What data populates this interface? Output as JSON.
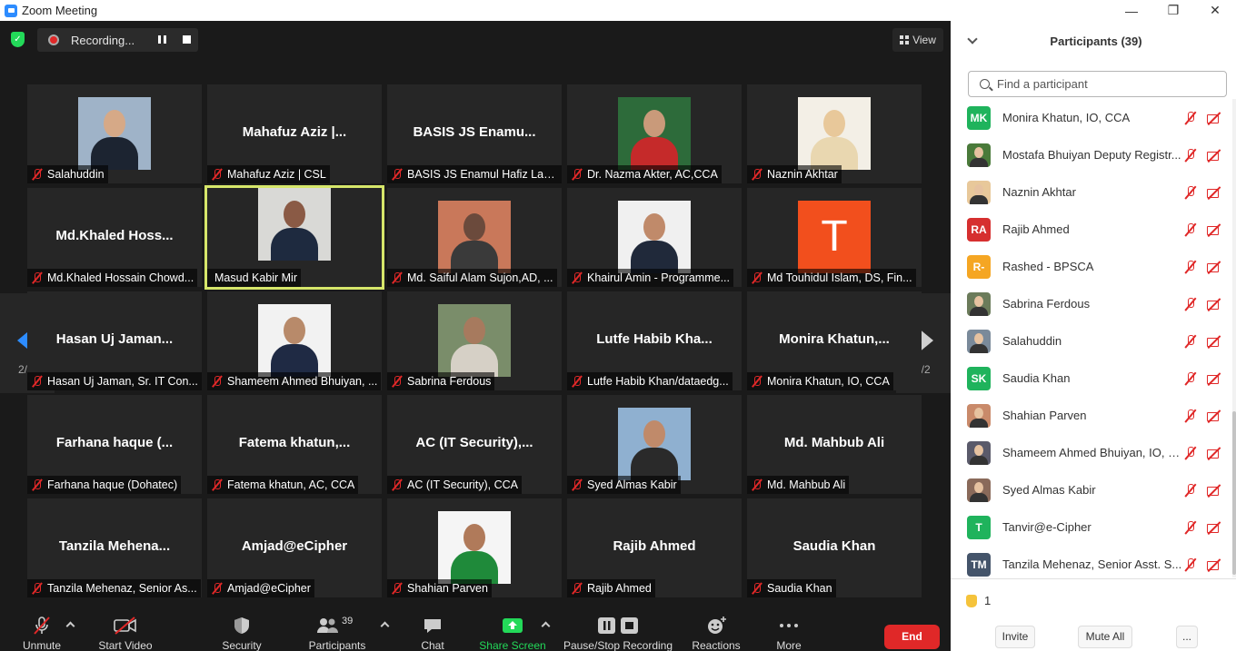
{
  "window": {
    "title": "Zoom Meeting",
    "controls": [
      "—",
      "❐",
      "✕"
    ]
  },
  "topbar": {
    "recording_label": "Recording...",
    "view_label": "View"
  },
  "grid": {
    "page_indicator": "2/2",
    "tiles": [
      {
        "big": "",
        "name": "Salahuddin",
        "photo": "man-suit"
      },
      {
        "big": "Mahafuz Aziz |...",
        "name": "Mahafuz Aziz | CSL"
      },
      {
        "big": "BASIS JS Enamu...",
        "name": "BASIS JS Enamul Hafiz Latif..."
      },
      {
        "big": "",
        "name": "Dr. Nazma Akter, AC,CCA",
        "photo": "woman-red"
      },
      {
        "big": "",
        "name": "Naznin Akhtar",
        "photo": "woman-hijab"
      },
      {
        "big": "Md.Khaled  Hoss...",
        "name": "Md.Khaled Hossain Chowd..."
      },
      {
        "big": "",
        "name": "Masud Kabir Mir",
        "photo": "man-office",
        "active": true
      },
      {
        "big": "",
        "name": "Md. Saiful Alam Sujon,AD, ...",
        "photo": "man-casual"
      },
      {
        "big": "",
        "name": "Khairul Amin - Programme...",
        "photo": "man-beard"
      },
      {
        "big": "",
        "name": "Md Touhidul Islam, DS, Fin...",
        "avatar_letter": "T"
      },
      {
        "big": "Hasan Uj Jaman...",
        "name": "Hasan Uj Jaman, Sr. IT Con..."
      },
      {
        "big": "",
        "name": "Shameem Ahmed Bhuiyan, ...",
        "photo": "man-suit2"
      },
      {
        "big": "",
        "name": "Sabrina Ferdous",
        "photo": "woman-outdoor"
      },
      {
        "big": "Lutfe  Habib  Kha...",
        "name": "Lutfe Habib Khan/dataedg..."
      },
      {
        "big": "Monira  Khatun,...",
        "name": "Monira Khatun, IO, CCA"
      },
      {
        "big": "Farhana haque (...",
        "name": "Farhana haque (Dohatec)"
      },
      {
        "big": "Fatema  khatun,...",
        "name": "Fatema khatun, AC, CCA"
      },
      {
        "big": "AC (IT Security),...",
        "name": "AC (IT Security), CCA"
      },
      {
        "big": "",
        "name": "Syed Almas Kabir",
        "photo": "man-smile"
      },
      {
        "big": "Md. Mahbub Ali",
        "name": "Md. Mahbub Ali"
      },
      {
        "big": "Tanzila  Mehena...",
        "name": "Tanzila Mehenaz, Senior As..."
      },
      {
        "big": "Amjad@eCipher",
        "name": "Amjad@eCipher"
      },
      {
        "big": "",
        "name": "Shahian Parven",
        "photo": "woman-green"
      },
      {
        "big": "Rajib Ahmed",
        "name": "Rajib Ahmed"
      },
      {
        "big": "Saudia Khan",
        "name": "Saudia Khan"
      }
    ]
  },
  "toolbar": {
    "unmute": "Unmute",
    "start_video": "Start Video",
    "security": "Security",
    "participants": "Participants",
    "participants_count": "39",
    "chat": "Chat",
    "share_screen": "Share Screen",
    "pause_stop": "Pause/Stop Recording",
    "reactions": "Reactions",
    "more": "More",
    "end": "End"
  },
  "panel": {
    "title": "Participants (39)",
    "search_placeholder": "Find a participant",
    "raised_hands": "1",
    "invite": "Invite",
    "mute_all": "Mute All",
    "more": "...",
    "participants": [
      {
        "name": "Monira Khatun, IO, CCA",
        "initials": "MK",
        "color": "#1fb35c"
      },
      {
        "name": "Mostafa Bhuiyan Deputy Registr...",
        "initials": "",
        "color": "#4a7a3a",
        "pic": true
      },
      {
        "name": "Naznin Akhtar",
        "initials": "",
        "color": "#e8c89a",
        "pic": true
      },
      {
        "name": "Rajib Ahmed",
        "initials": "RA",
        "color": "#d62f2f"
      },
      {
        "name": "Rashed - BPSCA",
        "initials": "R-",
        "color": "#f5a623"
      },
      {
        "name": "Sabrina Ferdous",
        "initials": "",
        "color": "#6b7b5a",
        "pic": true
      },
      {
        "name": "Salahuddin",
        "initials": "",
        "color": "#7a8a9a",
        "pic": true
      },
      {
        "name": "Saudia Khan",
        "initials": "SK",
        "color": "#1fb35c"
      },
      {
        "name": "Shahian Parven",
        "initials": "",
        "color": "#c98a6a",
        "pic": true
      },
      {
        "name": "Shameem Ahmed Bhuiyan, IO, C...",
        "initials": "",
        "color": "#5a5a6a",
        "pic": true
      },
      {
        "name": "Syed Almas Kabir",
        "initials": "",
        "color": "#8a6a5a",
        "pic": true
      },
      {
        "name": "Tanvir@e-Cipher",
        "initials": "T",
        "color": "#1fb35c"
      },
      {
        "name": "Tanzila Mehenaz, Senior Asst. S...",
        "initials": "TM",
        "color": "#44546a"
      }
    ]
  }
}
